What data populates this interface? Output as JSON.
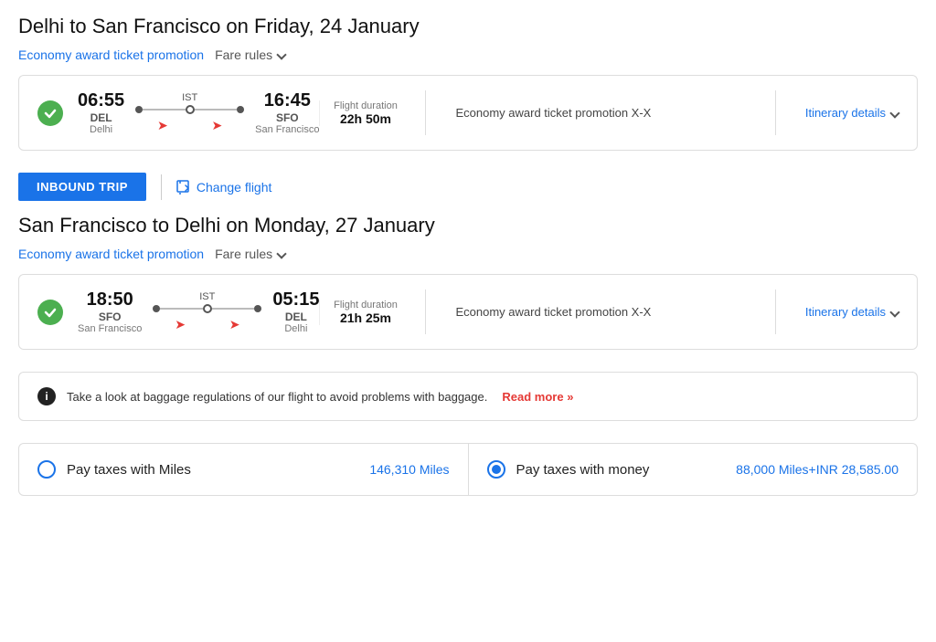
{
  "outbound": {
    "title": "Delhi to San Francisco on Friday, 24 January",
    "promo_label": "Economy award ticket promotion",
    "fare_rules_label": "Fare rules",
    "flight": {
      "dep_time": "06:55",
      "dep_code": "DEL",
      "dep_city": "Delhi",
      "arr_time": "16:45",
      "arr_code": "SFO",
      "arr_city": "San Francisco",
      "via_label": "IST",
      "duration_label": "Flight duration",
      "duration": "22h 50m",
      "promo_class": "Economy award ticket promotion X-X",
      "itinerary_label": "Itinerary details"
    }
  },
  "inbound_badge": "INBOUND TRIP",
  "change_flight_label": "Change flight",
  "inbound": {
    "title": "San Francisco to Delhi on Monday, 27 January",
    "promo_label": "Economy award ticket promotion",
    "fare_rules_label": "Fare rules",
    "flight": {
      "dep_time": "18:50",
      "dep_code": "SFO",
      "dep_city": "San Francisco",
      "arr_time": "05:15",
      "arr_code": "DEL",
      "arr_city": "Delhi",
      "via_label": "IST",
      "duration_label": "Flight duration",
      "duration": "21h 25m",
      "promo_class": "Economy award ticket promotion X-X",
      "itinerary_label": "Itinerary details"
    }
  },
  "baggage": {
    "text": "Take a look at baggage regulations of our flight to avoid problems with baggage.",
    "read_more": "Read more"
  },
  "payment": {
    "option1": {
      "label": "Pay taxes with Miles",
      "value": "146,310 Miles",
      "selected": false
    },
    "option2": {
      "label": "Pay taxes with money",
      "value": "88,000 Miles+INR 28,585.00",
      "selected": true
    }
  }
}
